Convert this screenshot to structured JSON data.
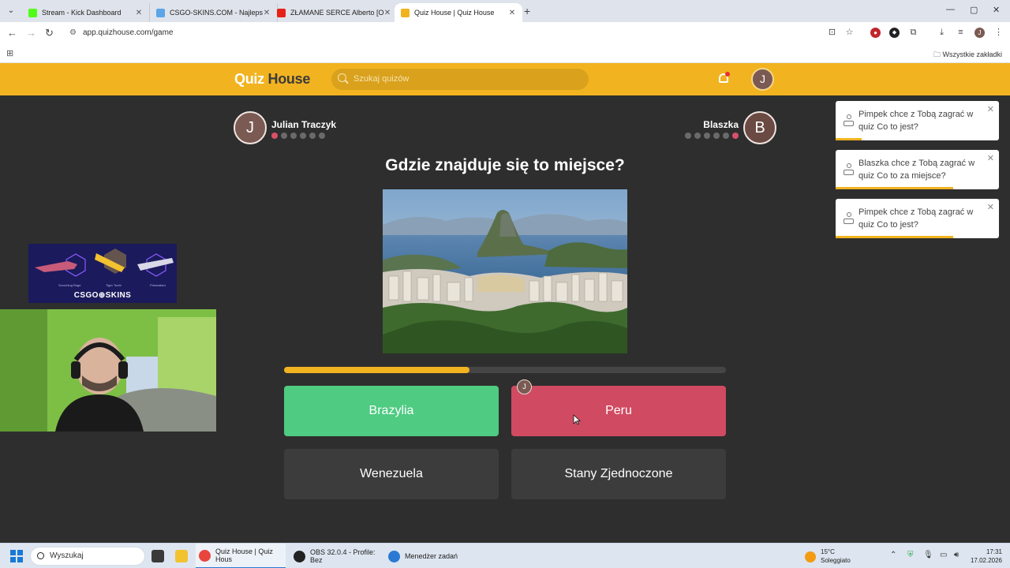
{
  "browser": {
    "tabs": [
      {
        "title": "Stream - Kick Dashboard",
        "favicon_color": "#53fc18"
      },
      {
        "title": "CSGO-SKINS.COM - Najlepsze",
        "favicon_color": "#5aa6e8"
      },
      {
        "title": "ZŁAMANE SERCE Alberto [O",
        "favicon_color": "#e62117"
      },
      {
        "title": "Quiz House | Quiz House",
        "favicon_color": "#f2b320"
      }
    ],
    "url": "app.quizhouse.com/game",
    "bookmarks_all_label": "Wszystkie zakładki"
  },
  "site": {
    "logo_quiz": "Quiz",
    "logo_house": "House",
    "search_placeholder": "Szukaj quizów",
    "user_initial": "J",
    "accent_color": "#f2b320"
  },
  "game": {
    "player_left": {
      "initial": "J",
      "name": "Julian Traczyk",
      "avatar_color": "#7a5a52",
      "scores": [
        1,
        0,
        0,
        0,
        0,
        0
      ]
    },
    "player_right": {
      "initial": "B",
      "name": "Blaszka",
      "avatar_color": "#6a4a42",
      "scores": [
        0,
        0,
        0,
        0,
        0,
        1
      ]
    },
    "question": "Gdzie znajduje się to miejsce?",
    "timer_progress": 0.42,
    "answers": [
      {
        "label": "Brazylia",
        "state": "correct"
      },
      {
        "label": "Peru",
        "state": "wrong"
      },
      {
        "label": "Wenezuela",
        "state": "neutral"
      },
      {
        "label": "Stany Zjednoczone",
        "state": "neutral"
      }
    ],
    "picked_by_initial": "J"
  },
  "notifications": [
    {
      "text": "Pimpek chce z Tobą zagrać w quiz Co to jest?",
      "remaining": 0.16
    },
    {
      "text": "Blaszka chce z Tobą zagrać w quiz Co to za miejsce?",
      "remaining": 0.72
    },
    {
      "text": "Pimpek chce z Tobą zagrać w quiz Co to jest?",
      "remaining": 0.72
    }
  ],
  "overlay": {
    "ad_brand": "CSGO⊕SKINS",
    "ad_captions": [
      "Scorching Rage",
      "Tiger Tooth",
      "Prismatism"
    ]
  },
  "taskbar": {
    "search_label": "Wyszukaj",
    "apps": [
      {
        "label": "Quiz House | Quiz Hous",
        "icon_color": "#e8453c"
      },
      {
        "label": "OBS 32.0.4 - Profile: Bez",
        "icon_color": "#222222"
      },
      {
        "label": "Menedżer zadań",
        "icon_color": "#2a7ad4"
      }
    ],
    "weather_temp": "15°C",
    "weather_desc": "Soleggiato",
    "time": "17:31",
    "date": "17.02.2026"
  }
}
